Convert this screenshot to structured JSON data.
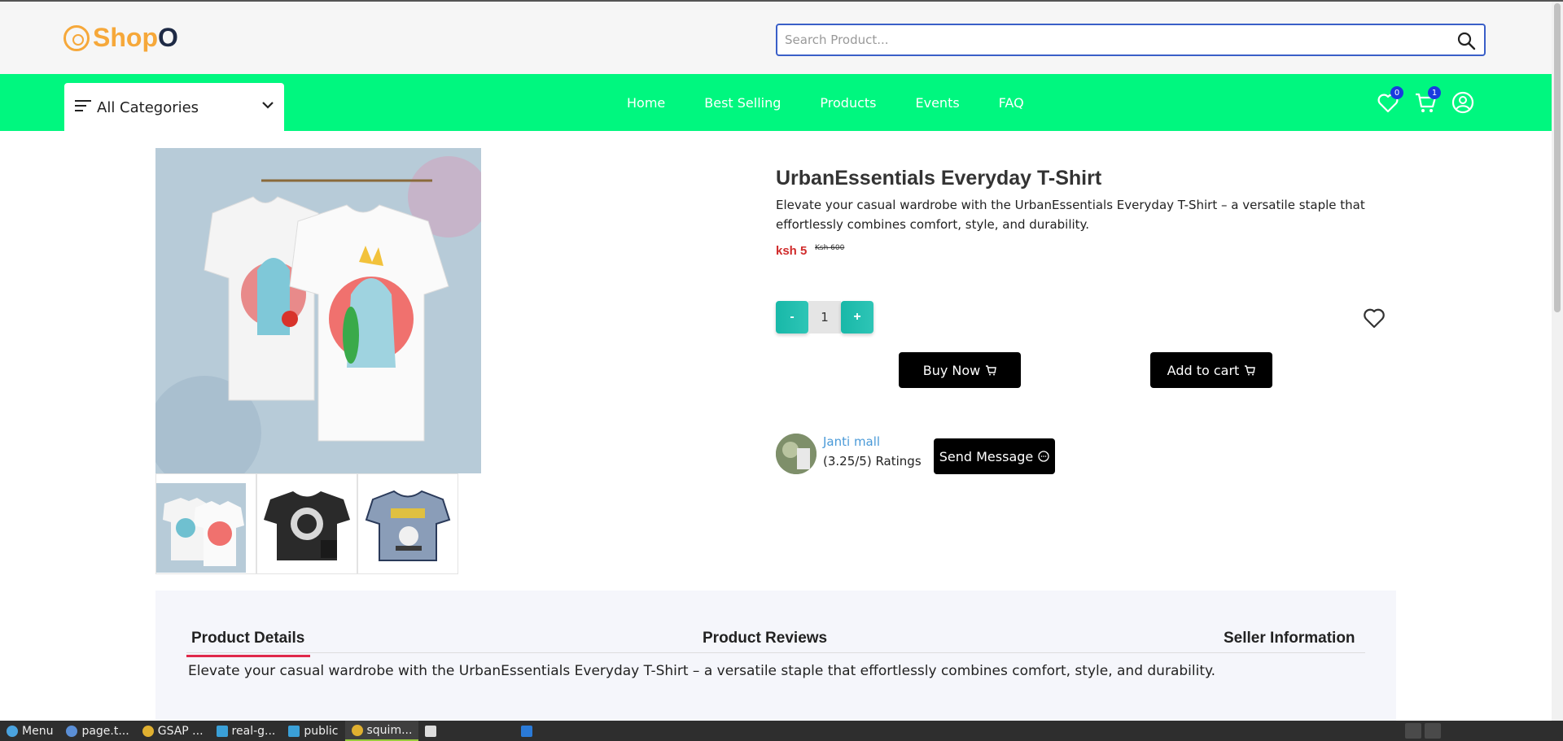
{
  "brand": {
    "name_main": "Shop",
    "name_accent": "O"
  },
  "search": {
    "placeholder": "Search Product..."
  },
  "categories": {
    "label": "All Categories"
  },
  "nav": {
    "links": [
      "Home",
      "Best Selling",
      "Products",
      "Events",
      "FAQ"
    ]
  },
  "header_icons": {
    "wishlist_count": "0",
    "cart_count": "1"
  },
  "product": {
    "title": "UrbanEssentials Everyday T-Shirt",
    "description": "Elevate your casual wardrobe with the UrbanEssentials Everyday T-Shirt – a versatile staple that effortlessly combines comfort, style, and durability.",
    "price": "ksh 5",
    "old_price": "Ksh 600",
    "quantity": "1",
    "decrement_label": "-",
    "increment_label": "+",
    "buy_now_label": "Buy Now",
    "add_to_cart_label": "Add to cart"
  },
  "seller": {
    "name": "Janti mall",
    "rating": "(3.25/5) Ratings",
    "message_label": "Send Message"
  },
  "tabs": {
    "details": "Product Details",
    "reviews": "Product Reviews",
    "seller_info": "Seller Information",
    "details_text": "Elevate your casual wardrobe with the UrbanEssentials Everyday T-Shirt – a versatile staple that effortlessly combines comfort, style, and durability."
  },
  "taskbar": {
    "items": [
      "Menu",
      "page.t...",
      "GSAP ...",
      "real-g...",
      "public",
      "squim..."
    ]
  },
  "colors": {
    "brand": "#f6a83a",
    "nav_bg": "#00f77f",
    "price": "#d02b2b",
    "qty_button": "#18b8a8",
    "tab_underline": "#e0284a",
    "seller_link": "#4a9ad8"
  },
  "icons": [
    "search-icon",
    "menu-lines-icon",
    "chevron-down-icon",
    "heart-icon",
    "cart-icon",
    "user-icon",
    "chat-icon"
  ]
}
